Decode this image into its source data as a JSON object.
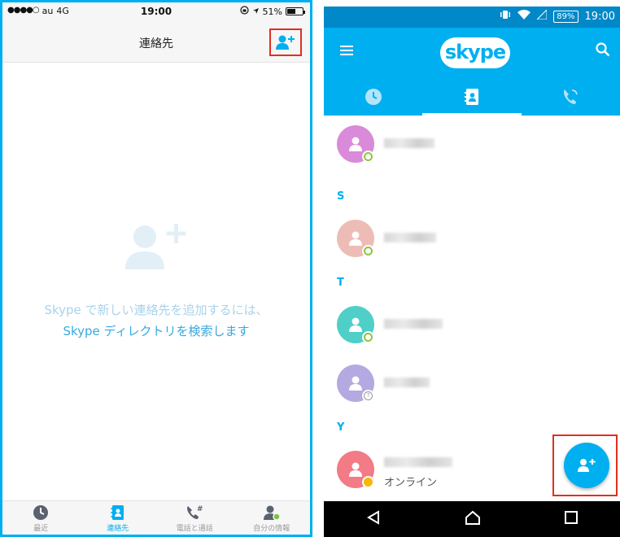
{
  "ios": {
    "status": {
      "carrier": "au",
      "network": "4G",
      "time": "19:00",
      "battery": "51%",
      "battery_level": 0.51
    },
    "navbar": {
      "title": "連絡先",
      "add_icon": "add-contact-icon"
    },
    "empty": {
      "line1": "Skype で新しい連絡先を追加するには、",
      "line2": "Skype ディレクトリを検索します"
    },
    "tabs": [
      {
        "label": "最近",
        "icon": "clock-icon"
      },
      {
        "label": "連絡先",
        "icon": "contacts-book-icon"
      },
      {
        "label": "電話と通話",
        "icon": "phone-dialpad-icon"
      },
      {
        "label": "自分の情報",
        "icon": "profile-icon"
      }
    ],
    "accent": "#00aff0",
    "highlight": "#e0301e"
  },
  "android": {
    "status": {
      "battery": "89%",
      "time": "19:00"
    },
    "appbar": {
      "logo": "skype",
      "menu_icon": "hamburger-icon",
      "search_icon": "search-icon"
    },
    "tabs": [
      {
        "icon": "clock-icon"
      },
      {
        "icon": "contacts-book-icon"
      },
      {
        "icon": "phone-call-icon"
      }
    ],
    "sections": [
      "S",
      "T",
      "Y"
    ],
    "contacts": [
      {
        "color": "#d98ad8",
        "presence": "online"
      },
      {
        "color": "#eebcb6",
        "presence": "online"
      },
      {
        "color": "#4fcfc8",
        "presence": "online"
      },
      {
        "color": "#b4a9e0",
        "presence": "unknown"
      },
      {
        "color": "#f27b86",
        "presence": "away",
        "status": "オンライン"
      }
    ],
    "fab_icon": "add-contact-icon",
    "accent": "#00aff0",
    "highlight": "#e0301e"
  }
}
